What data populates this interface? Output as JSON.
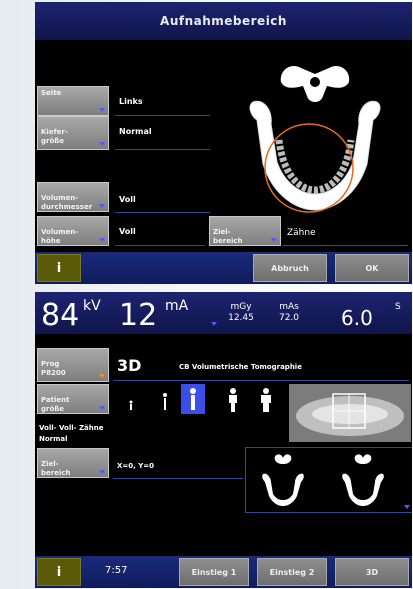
{
  "panel1": {
    "title": "Aufnahmebereich",
    "seite": {
      "label": "Seite",
      "value": "Links"
    },
    "kiefer": {
      "label": "Kiefer-\ngröße",
      "value": "Normal"
    },
    "volumen_durchmesser": {
      "label": "Volumen-\ndurchmesser",
      "value": "Voll"
    },
    "volumen_hoehe": {
      "label": "Volumen-\nhöhe",
      "value": "Voll"
    },
    "zielbereich": {
      "label": "Ziel-\nbereich",
      "value": "Zähne"
    },
    "buttons": {
      "info": "i",
      "abbruch": "Abbruch",
      "ok": "OK"
    }
  },
  "panel2": {
    "kv_value": "84",
    "kv_unit": "kV",
    "ma_value": "12",
    "ma_unit": "mA",
    "mgy_label": "mGy",
    "mgy_value": "12.45",
    "mas_label": "mAs",
    "mas_value": "72.0",
    "time_value": "6.0",
    "time_unit": "S",
    "prog": {
      "label": "Prog\nP8200",
      "mode": "3D",
      "desc": "CB Volumetrische Tomographie"
    },
    "patient": {
      "label": "Patient\ngröße"
    },
    "summary_line1": "Voll- Voll- Zähne",
    "summary_line2": "Normal",
    "ziel": {
      "label": "Ziel-\nbereich",
      "value": "X=0, Y=0"
    },
    "bottom": {
      "info": "i",
      "time": "7:57",
      "einstieg1": "Einstieg 1",
      "einstieg2": "Einstieg 2",
      "mode_3d": "3D"
    }
  },
  "colors": {
    "title_bg": "#141a5c",
    "button_gray": "#8a8a8a",
    "info_olive": "#5b5a08",
    "accent_blue": "#4a5cff",
    "highlight_blue": "#3b4fe6",
    "orange": "#ff8a1a"
  }
}
